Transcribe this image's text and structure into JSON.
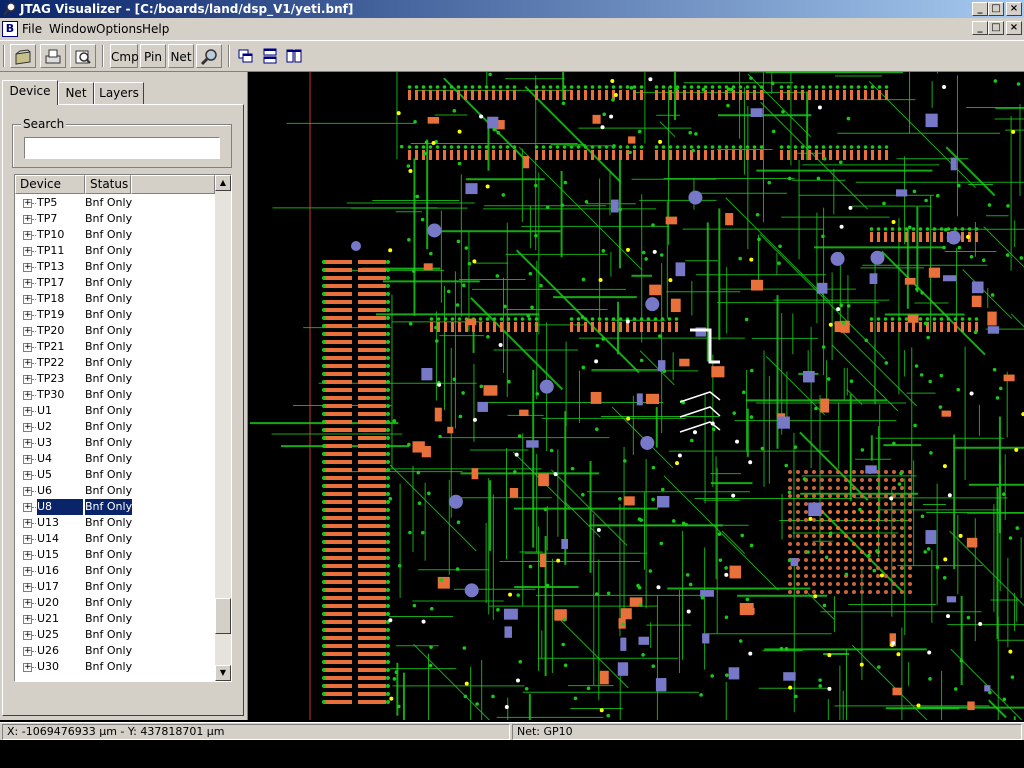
{
  "window": {
    "title": "JTAG Visualizer - [C:/boards/land/dsp_V1/yeti.bnf]",
    "controls": {
      "minimize": "_",
      "maximize": "□",
      "close": "×"
    }
  },
  "menu": {
    "doc_icon": "B",
    "items": [
      {
        "label": "File"
      },
      {
        "label": "Window"
      },
      {
        "label": "Options"
      },
      {
        "label": "Help"
      }
    ]
  },
  "toolbar": {
    "buttons": [
      {
        "icon": "open-folder-icon"
      },
      {
        "icon": "print-icon"
      },
      {
        "icon": "print-preview-icon"
      },
      {
        "label": "Cmp"
      },
      {
        "label": "Pin"
      },
      {
        "label": "Net"
      },
      {
        "icon": "magnifier-icon"
      },
      {
        "icon": "cascade-windows-icon"
      },
      {
        "icon": "tile-horizontal-icon"
      },
      {
        "icon": "tile-vertical-icon"
      }
    ]
  },
  "tabs": [
    {
      "label": "Device",
      "active": true
    },
    {
      "label": "Net",
      "active": false
    },
    {
      "label": "Layers",
      "active": false
    }
  ],
  "search": {
    "label": "Search",
    "value": "",
    "placeholder": ""
  },
  "device_list": {
    "columns": [
      "Device",
      "Status"
    ],
    "selected": "U8",
    "rows": [
      {
        "device": "TP5",
        "status": "Bnf Only"
      },
      {
        "device": "TP7",
        "status": "Bnf Only"
      },
      {
        "device": "TP10",
        "status": "Bnf Only"
      },
      {
        "device": "TP11",
        "status": "Bnf Only"
      },
      {
        "device": "TP13",
        "status": "Bnf Only"
      },
      {
        "device": "TP17",
        "status": "Bnf Only"
      },
      {
        "device": "TP18",
        "status": "Bnf Only"
      },
      {
        "device": "TP19",
        "status": "Bnf Only"
      },
      {
        "device": "TP20",
        "status": "Bnf Only"
      },
      {
        "device": "TP21",
        "status": "Bnf Only"
      },
      {
        "device": "TP22",
        "status": "Bnf Only"
      },
      {
        "device": "TP23",
        "status": "Bnf Only"
      },
      {
        "device": "TP30",
        "status": "Bnf Only"
      },
      {
        "device": "U1",
        "status": "Bnf Only"
      },
      {
        "device": "U2",
        "status": "Bnf Only"
      },
      {
        "device": "U3",
        "status": "Bnf Only"
      },
      {
        "device": "U4",
        "status": "Bnf Only"
      },
      {
        "device": "U5",
        "status": "Bnf Only"
      },
      {
        "device": "U6",
        "status": "Bnf Only"
      },
      {
        "device": "U8",
        "status": "Bnf Only"
      },
      {
        "device": "U13",
        "status": "Bnf Only"
      },
      {
        "device": "U14",
        "status": "Bnf Only"
      },
      {
        "device": "U15",
        "status": "Bnf Only"
      },
      {
        "device": "U16",
        "status": "Bnf Only"
      },
      {
        "device": "U17",
        "status": "Bnf Only"
      },
      {
        "device": "U20",
        "status": "Bnf Only"
      },
      {
        "device": "U21",
        "status": "Bnf Only"
      },
      {
        "device": "U25",
        "status": "Bnf Only"
      },
      {
        "device": "U26",
        "status": "Bnf Only"
      },
      {
        "device": "U30",
        "status": "Bnf Only"
      }
    ],
    "scroll_position": 0.93
  },
  "status_bar": {
    "coordinates": "X: -1069476933 µm - Y: 437818701 µm",
    "net": "Net: GP10"
  },
  "pcb": {
    "colors": {
      "background": "#000000",
      "trace": "#19c819",
      "pad": "#e8703a",
      "via": "#7878c8",
      "highlight": "#ffffff",
      "marker": "#ffff00"
    }
  }
}
